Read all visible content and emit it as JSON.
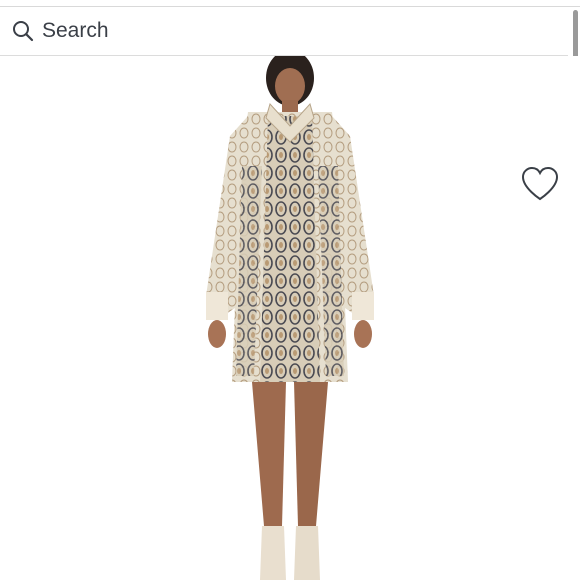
{
  "search": {
    "placeholder": "Search",
    "value": ""
  },
  "icons": {
    "search": "search-icon",
    "favorite": "heart-outline-icon"
  },
  "product": {
    "image_description_name": "product-image"
  },
  "colors": {
    "text": "#3a3f47",
    "divider": "#dcdcdc"
  }
}
